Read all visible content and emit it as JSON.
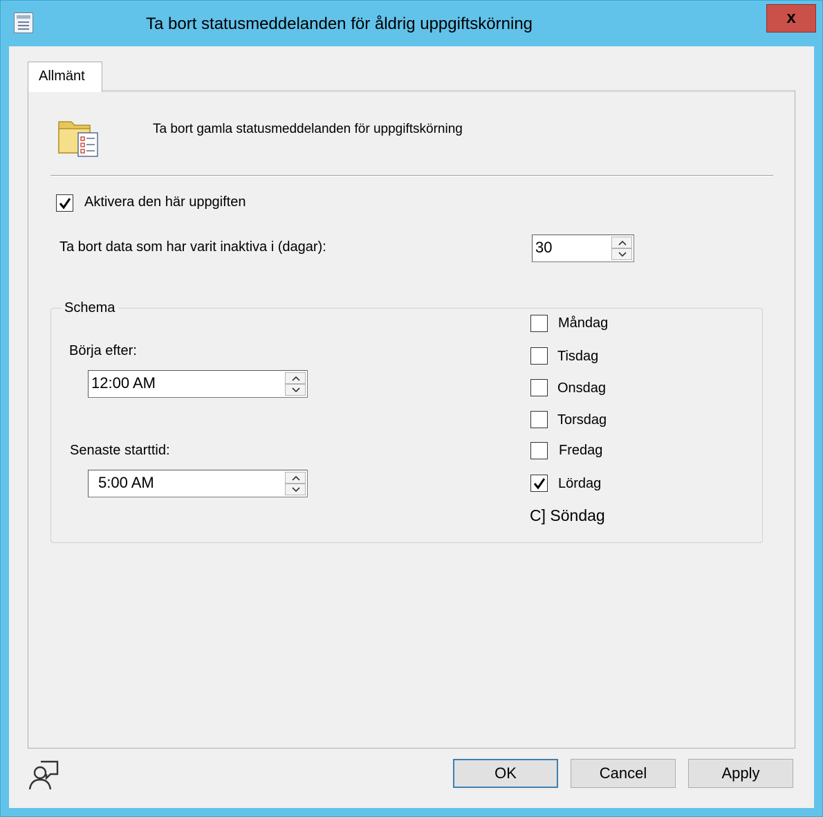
{
  "window": {
    "title": "Ta bort statusmeddelanden för åldrig uppgiftskörning",
    "close_label": "x"
  },
  "tabs": [
    {
      "label": "Allmänt",
      "active": true
    }
  ],
  "header": {
    "icon": "folder-checklist-icon",
    "description": "Ta bort gamla statusmeddelanden för uppgiftskörning"
  },
  "enable_task": {
    "label": "Aktivera den här uppgiften",
    "checked": true
  },
  "inactive_days": {
    "label": "Ta bort data som har varit inaktiva i (dagar):",
    "value": "30"
  },
  "schedule": {
    "title": "Schema",
    "start_after_label": "Börja efter:",
    "start_after_value": "12:00 AM",
    "latest_start_label": "Senaste starttid:",
    "latest_start_value": "5:00 AM",
    "days": [
      {
        "label": "Måndag",
        "checked": false
      },
      {
        "label": "Tisdag",
        "checked": false
      },
      {
        "label": "Onsdag",
        "checked": false
      },
      {
        "label": "Torsdag",
        "checked": false
      },
      {
        "label": "Fredag",
        "checked": false
      },
      {
        "label": "Lördag",
        "checked": true
      }
    ],
    "sunday_label": "C] Söndag"
  },
  "buttons": {
    "ok": "OK",
    "cancel": "Cancel",
    "apply": "Apply"
  },
  "colors": {
    "frame": "#62c3ea",
    "client": "#f0f0f0",
    "close": "#c9514a",
    "default_button_border": "#3c7fb1"
  }
}
